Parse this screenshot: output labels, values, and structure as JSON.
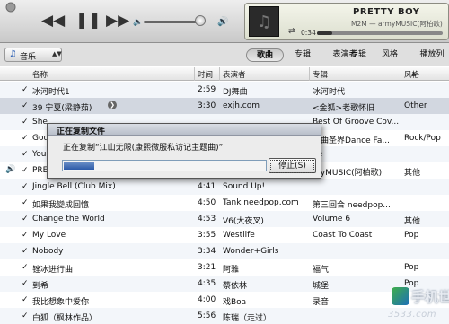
{
  "player": {
    "prev_icon": "rewind-icon",
    "pause_icon": "pause-icon",
    "next_icon": "fast-forward-icon",
    "volume_low_icon": "speaker-low-icon",
    "volume_high_icon": "speaker-high-icon",
    "volume_level": 0.95,
    "now_playing": {
      "title": "PRETTY BOY",
      "subtitle": "M2M — armyMUSIC(阿柏歌)",
      "elapsed": "0:34",
      "progress": 0.12
    }
  },
  "sourcebar": {
    "source_label": "音乐",
    "view_tabs": [
      {
        "label": "歌曲",
        "active": true
      },
      {
        "label": "专辑",
        "active": false
      },
      {
        "label": "表演者",
        "active": false
      },
      {
        "label": "专辑",
        "active": false
      },
      {
        "label": "风格",
        "active": false
      },
      {
        "label": "播放列",
        "active": false
      }
    ]
  },
  "table": {
    "headers": {
      "name": "名称",
      "time": "时间",
      "artist": "表演者",
      "album": "专辑",
      "genre": "风格"
    },
    "rows": [
      {
        "check": "✓",
        "name": "冰河时代1",
        "time": "2:59",
        "artist": "DJ舞曲",
        "album": "冰河时代",
        "genre": ""
      },
      {
        "check": "✓",
        "name": "39 宁夏(梁静茹)",
        "time": "3:30",
        "artist": "exjh.com",
        "album": "<金狐>老歌怀旧",
        "genre": "Other"
      },
      {
        "check": "✓",
        "name": "She",
        "time": "",
        "artist": "",
        "album": "Best Of Groove Cov...",
        "genre": ""
      },
      {
        "check": "✓",
        "name": "God",
        "time": "",
        "artist": "",
        "album": "劲曲圣界Dance Fa...",
        "genre": "Rock/Pop"
      },
      {
        "check": "✓",
        "name": "You I",
        "time": "",
        "artist": "",
        "album": "pe",
        "genre": ""
      },
      {
        "check": "✓",
        "name": "PRET",
        "time": "",
        "artist": "",
        "album": "myMUSIC(阿柏歌)",
        "genre": "其他"
      },
      {
        "check": "✓",
        "name": "Jingle Bell (Club Mix)",
        "time": "4:41",
        "artist": "Sound Up!",
        "album": "",
        "genre": ""
      },
      {
        "check": "✓",
        "name": "如果我變成回憶",
        "time": "4:50",
        "artist": "Tank needpop.com",
        "album": "第三回合 needpop...",
        "genre": ""
      },
      {
        "check": "✓",
        "name": "Change the World",
        "time": "4:53",
        "artist": "V6(大夜叉)",
        "album": "Volume 6",
        "genre": "其他"
      },
      {
        "check": "✓",
        "name": "My Love",
        "time": "3:55",
        "artist": "Westlife",
        "album": "Coast To Coast",
        "genre": "Pop"
      },
      {
        "check": "✓",
        "name": "Nobody",
        "time": "3:34",
        "artist": "Wonder+Girls",
        "album": "",
        "genre": ""
      },
      {
        "check": "✓",
        "name": "锉冰进行曲",
        "time": "3:21",
        "artist": "阿雅",
        "album": "福气",
        "genre": "Pop"
      },
      {
        "check": "✓",
        "name": "到希",
        "time": "4:35",
        "artist": "蔡依林",
        "album": "城堡",
        "genre": "Pop"
      },
      {
        "check": "✓",
        "name": "我比想象中爱你",
        "time": "4:00",
        "artist": "戏Boa",
        "album": "录音",
        "genre": ""
      },
      {
        "check": "✓",
        "name": "白狐（枫林作品）",
        "time": "5:56",
        "artist": "陈瑞（走过）",
        "album": "",
        "genre": ""
      }
    ]
  },
  "dialog": {
    "title": "正在复制文件",
    "message": "正在复制“江山无限(康熙微服私访记主题曲)”",
    "progress": 0.15,
    "stop_label": "停止(S)"
  },
  "watermark": {
    "brand": "手机世界",
    "site": "3533.com"
  }
}
